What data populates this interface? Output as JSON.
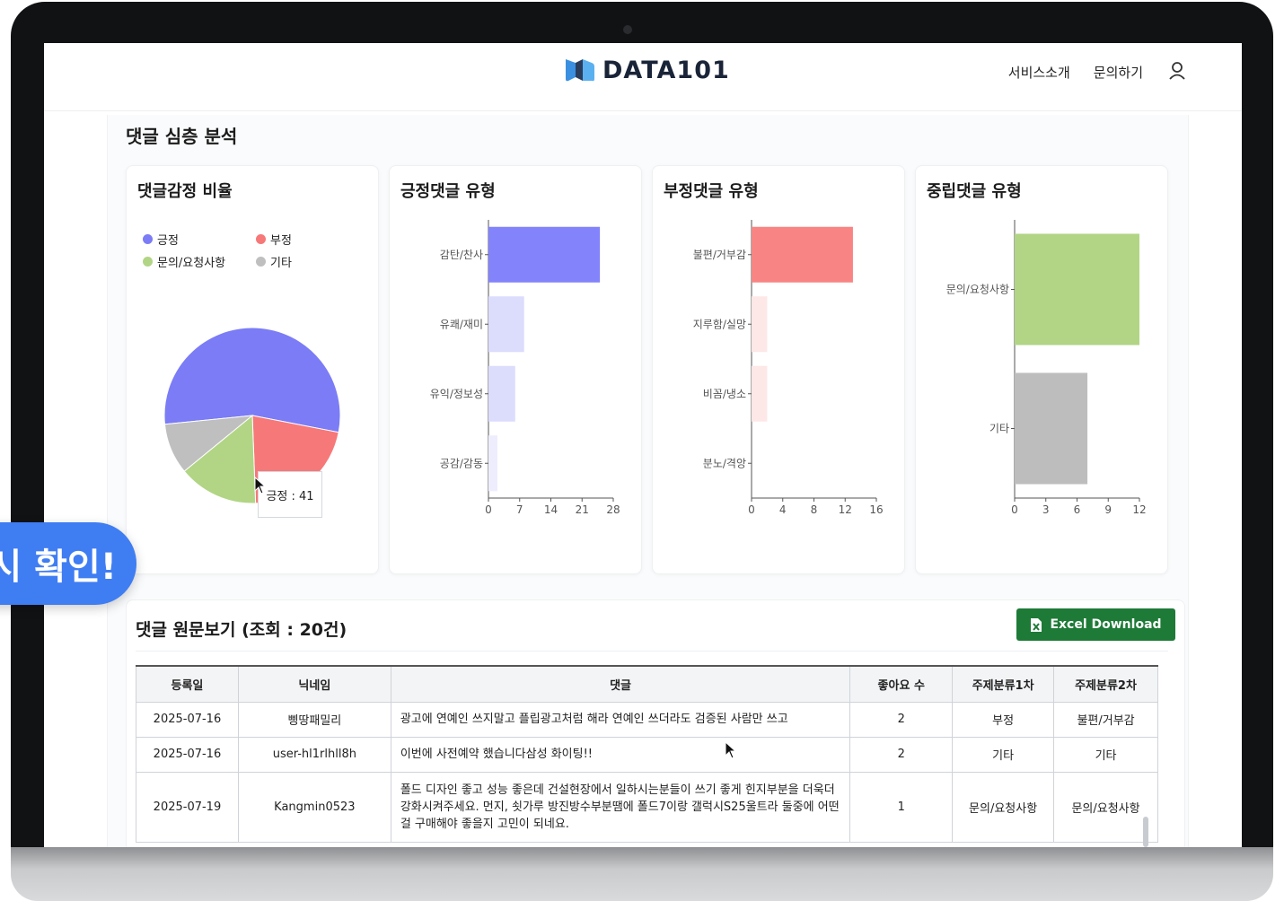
{
  "app": {
    "logo_text": "DATA101",
    "nav": [
      "서비스소개",
      "문의하기"
    ]
  },
  "section": {
    "title": "댓글 심층 분석"
  },
  "sentiment_card": {
    "title": "댓글감정 비율",
    "legend": [
      {
        "label": "긍정",
        "color": "#7b7cf6"
      },
      {
        "label": "부정",
        "color": "#f77878"
      },
      {
        "label": "문의/요청사항",
        "color": "#b1d585"
      },
      {
        "label": "기타",
        "color": "#bfbfbf"
      }
    ],
    "tooltip": "긍정 : 41"
  },
  "positive_card": {
    "title": "긍정댓글 유형"
  },
  "negative_card": {
    "title": "부정댓글 유형"
  },
  "neutral_card": {
    "title": "중립댓글 유형"
  },
  "chart_data": [
    {
      "type": "pie",
      "title": "댓글감정 비율",
      "categories": [
        "긍정",
        "부정",
        "문의/요청사항",
        "기타"
      ],
      "values": [
        41,
        16,
        11,
        7
      ],
      "colors": [
        "#7b7cf6",
        "#f77878",
        "#b1d585",
        "#bfbfbf"
      ]
    },
    {
      "type": "bar",
      "orientation": "horizontal",
      "title": "긍정댓글 유형",
      "categories": [
        "감탄/찬사",
        "유쾌/재미",
        "유익/정보성",
        "공감/감동"
      ],
      "values": [
        25,
        8,
        6,
        2
      ],
      "colors": [
        "#8383fb",
        "#dcdcfd",
        "#dcdcfd",
        "#ededfe"
      ],
      "xlim": [
        0,
        28
      ],
      "ticks": [
        "0",
        "7",
        "14",
        "21",
        "28"
      ]
    },
    {
      "type": "bar",
      "orientation": "horizontal",
      "title": "부정댓글 유형",
      "categories": [
        "불편/거부감",
        "지루함/실망",
        "비꼼/냉소",
        "분노/격앙"
      ],
      "values": [
        13,
        2,
        2,
        0
      ],
      "colors": [
        "#f98484",
        "#fde7e7",
        "#fde7e7",
        "#fde7e7"
      ],
      "xlim": [
        0,
        16
      ],
      "ticks": [
        "0",
        "4",
        "8",
        "12",
        "16"
      ]
    },
    {
      "type": "bar",
      "orientation": "horizontal",
      "title": "중립댓글 유형",
      "categories": [
        "문의/요청사항",
        "기타"
      ],
      "values": [
        12,
        7
      ],
      "colors": [
        "#b1d585",
        "#bdbdbd"
      ],
      "xlim": [
        0,
        12
      ],
      "ticks": [
        "0",
        "3",
        "6",
        "9",
        "12"
      ]
    }
  ],
  "comments": {
    "title": "댓글 원문보기 (조회 : 20건)",
    "excel_label": "Excel Download",
    "headers": [
      "등록일",
      "닉네임",
      "댓글",
      "좋아요 수",
      "주제분류1차",
      "주제분류2차"
    ],
    "rows": [
      [
        "2025-07-16",
        "삥땅패밀리",
        "광고에 연예인 쓰지말고 플립광고처럼 해라 연예인 쓰더라도 검증된 사람만 쓰고",
        "2",
        "부정",
        "불편/거부감"
      ],
      [
        "2025-07-16",
        "user-hl1rlhll8h",
        "이번에 사전예약 했습니다삼성 화이팅!!",
        "2",
        "기타",
        "기타"
      ],
      [
        "2025-07-19",
        "Kangmin0523",
        "폴드 디자인 좋고 성능 좋은데 건설현장에서 일하시는분들이 쓰기 좋게 힌지부분을 더욱더 강화시켜주세요. 먼지, 쇳가루 방진방수부분땜에 폴드7이랑 갤럭시S25울트라 둘중에 어떤걸 구매해야 좋을지 고민이 되네요.",
        "1",
        "문의/요청사항",
        "문의/요청사항"
      ]
    ]
  },
  "promo": {
    "text": "시 확인!"
  }
}
